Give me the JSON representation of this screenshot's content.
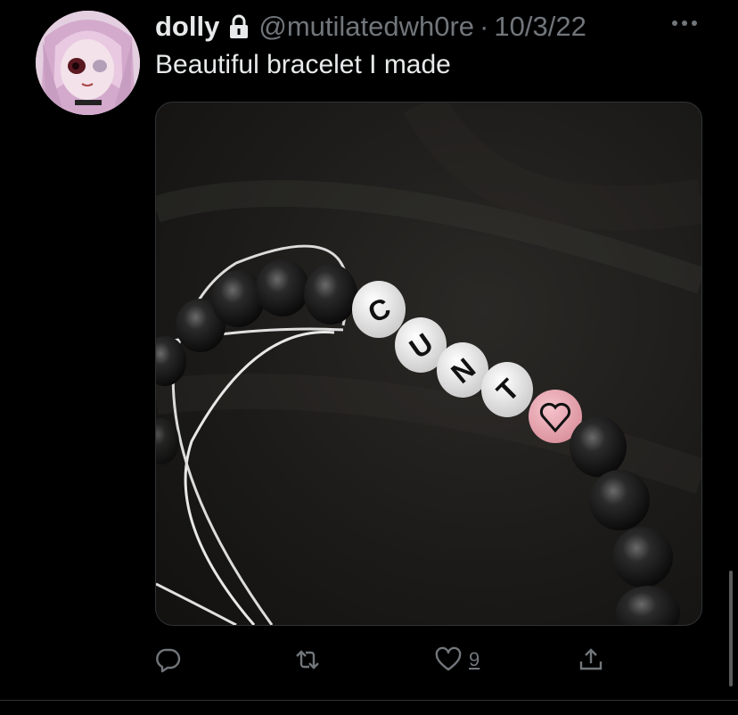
{
  "tweet": {
    "display_name": "dolly",
    "handle": "@mutilatedwh0re",
    "separator": "·",
    "date": "10/3/22",
    "text": "Beautiful bracelet I made",
    "icons": {
      "locked": "lock-icon",
      "more": "more-icon",
      "reply": "reply-icon",
      "retweet": "retweet-icon",
      "like": "heart-icon",
      "share": "share-icon"
    },
    "media": {
      "bead_letters": [
        "C",
        "U",
        "N",
        "T"
      ],
      "heart_bead_symbol": "♡"
    },
    "stats": {
      "likes": "9"
    },
    "colors": {
      "background": "#000000",
      "text_primary": "#e7e9ea",
      "text_secondary": "#71767b",
      "divider": "#2f3336",
      "pink_bead": "#e9a7b2"
    }
  }
}
